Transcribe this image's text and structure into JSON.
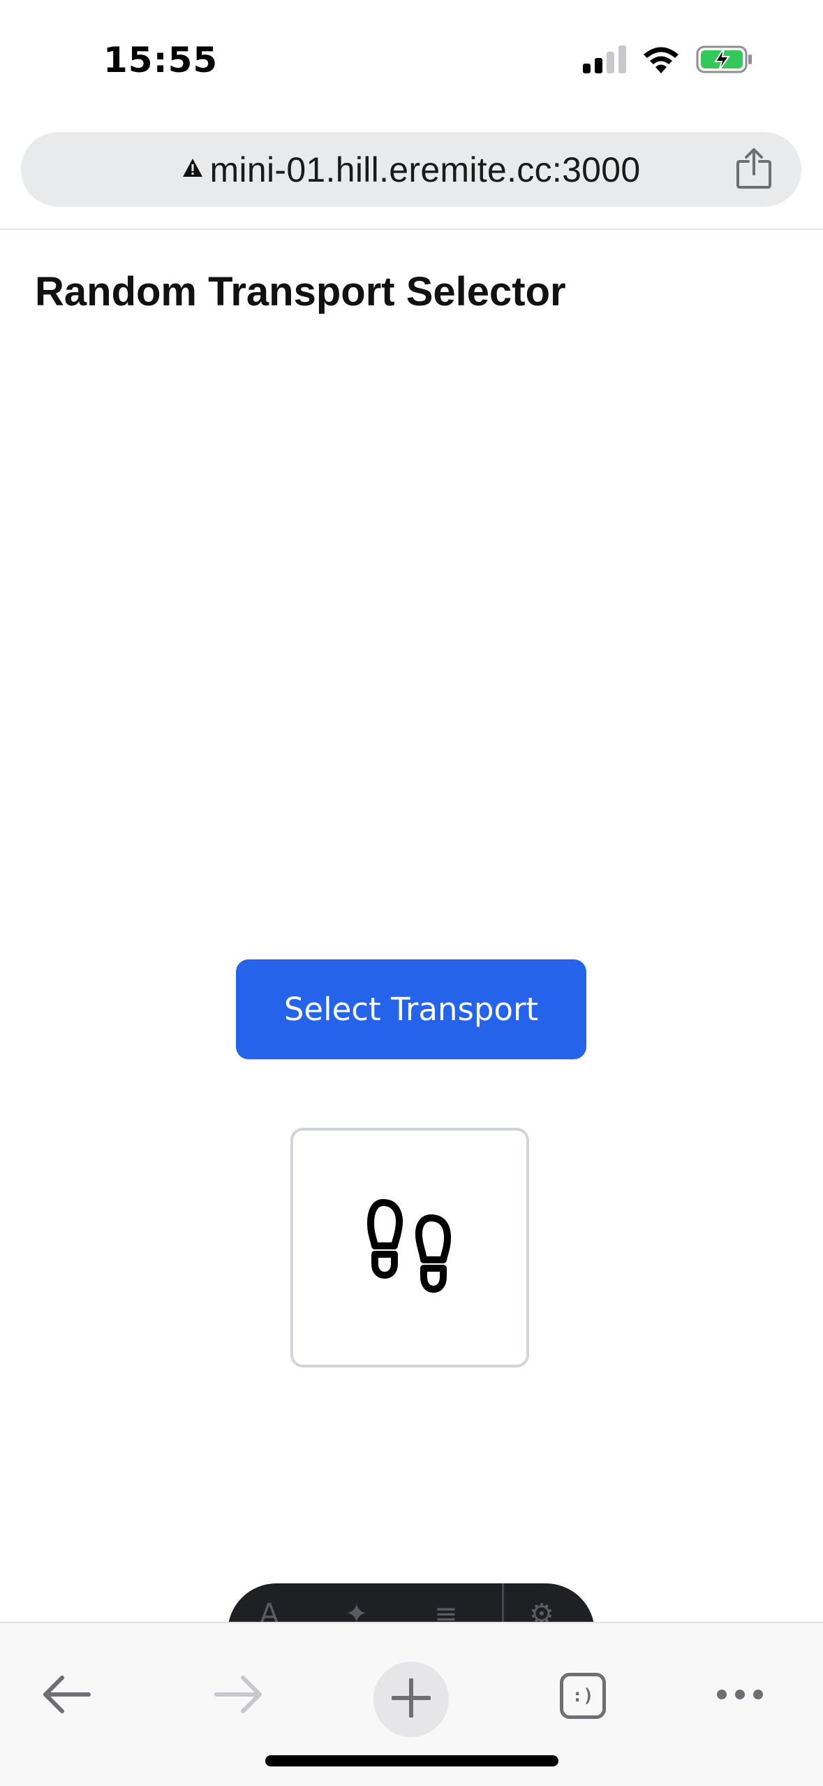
{
  "status_bar": {
    "time": "15:55",
    "icons": [
      "cellular-signal-icon",
      "wifi-icon",
      "battery-charging-icon"
    ],
    "battery_color": "#34c759"
  },
  "browser": {
    "url": "mini-01.hill.eremite.cc:3000",
    "url_icons": [
      "warning-icon",
      "share-icon"
    ]
  },
  "page": {
    "title": "Random Transport Selector",
    "select_button_label": "Select Transport",
    "result_icon": "footprints-icon",
    "accent_color": "#2563eb"
  },
  "bottom_nav": {
    "icons": [
      "back-arrow-icon",
      "forward-arrow-icon",
      "plus-icon",
      "tabs-icon",
      "more-icon"
    ],
    "tabs_glyph": ":)"
  }
}
